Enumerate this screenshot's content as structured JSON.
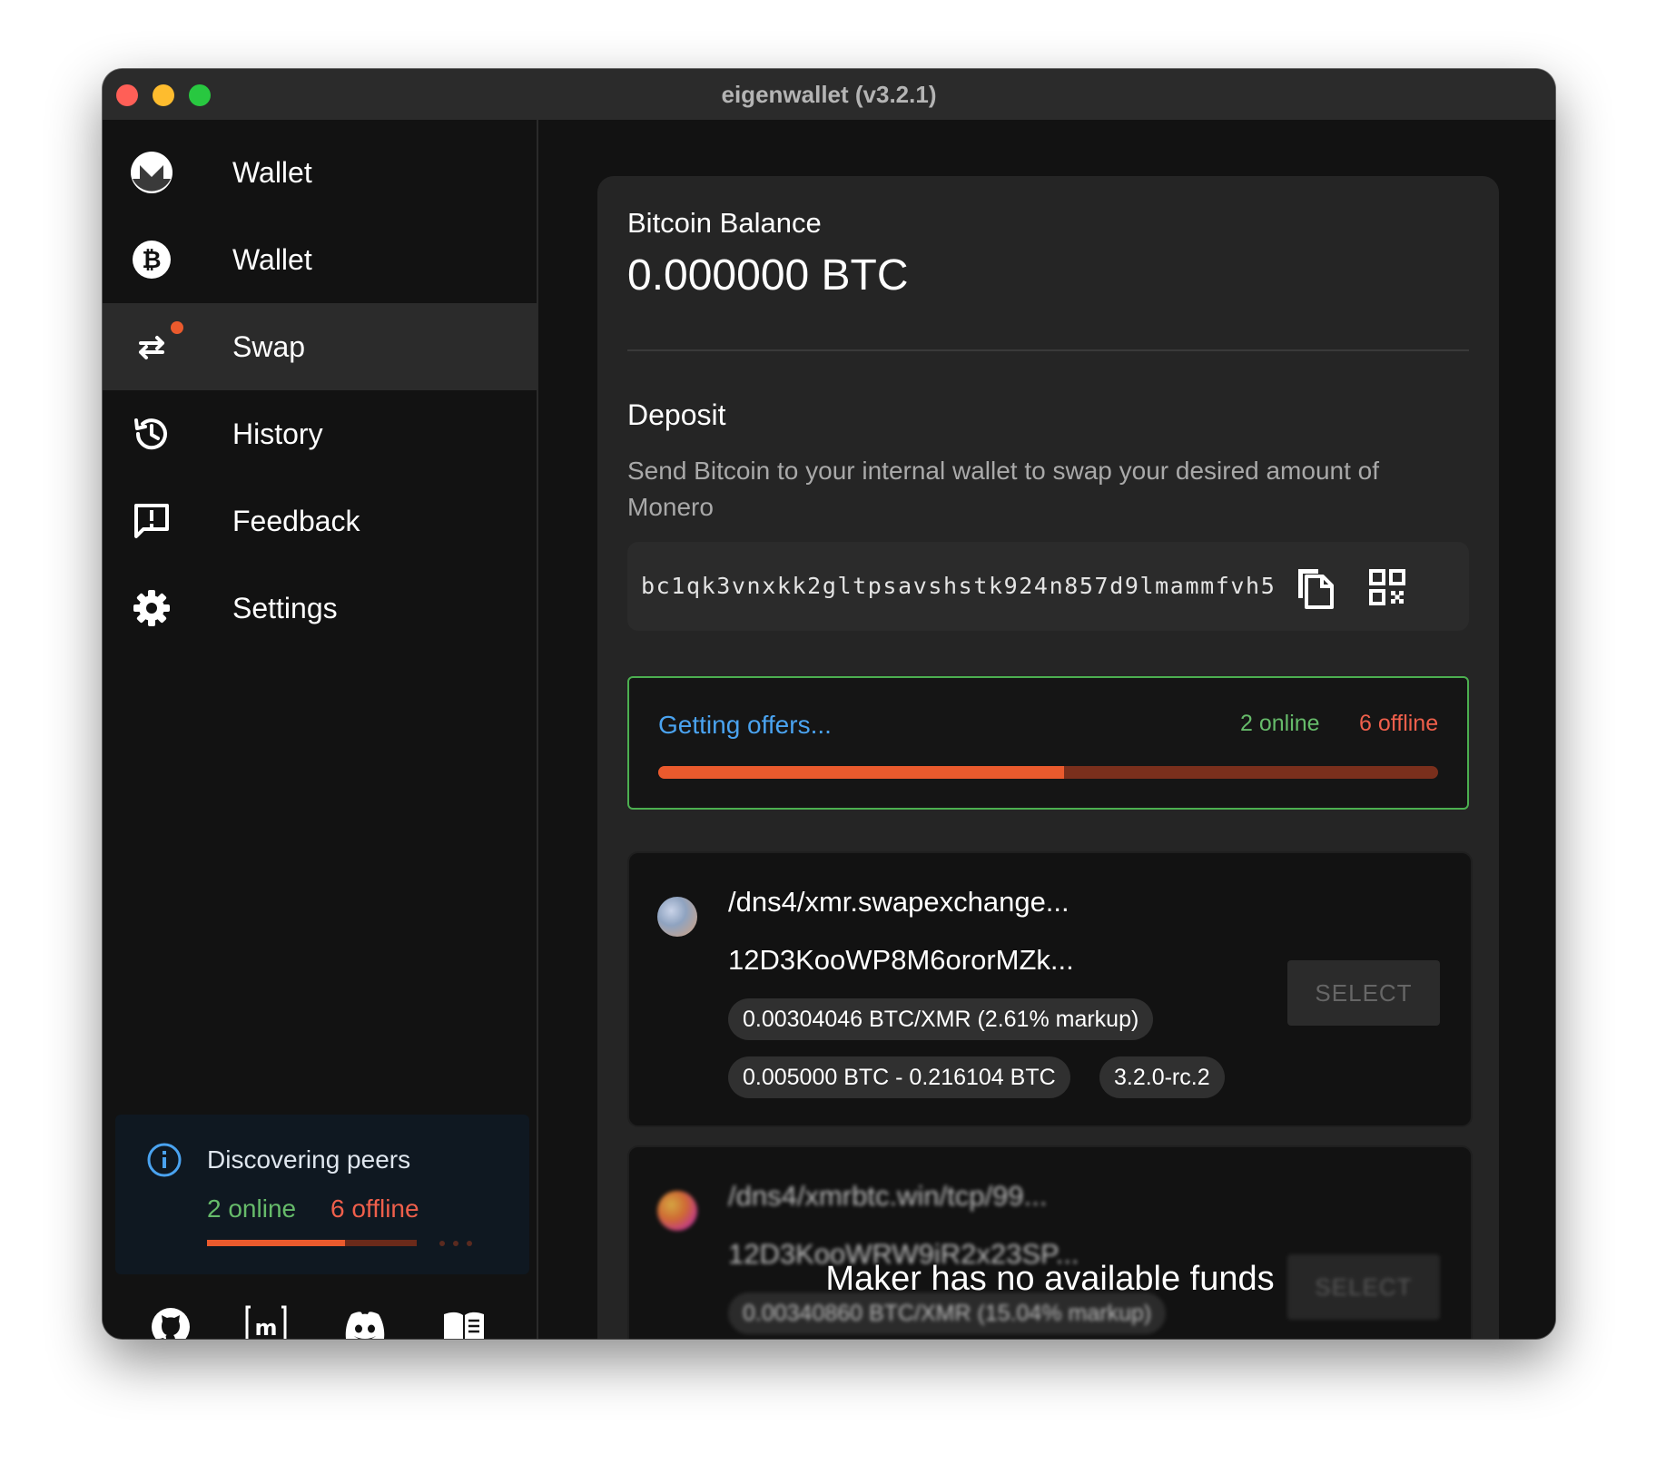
{
  "window": {
    "title": "eigenwallet (v3.2.1)"
  },
  "sidebar": {
    "items": [
      {
        "label": "Wallet",
        "icon": "monero-icon"
      },
      {
        "label": "Wallet",
        "icon": "bitcoin-icon"
      },
      {
        "label": "Swap",
        "icon": "swap-icon",
        "active": true,
        "notification": true
      },
      {
        "label": "History",
        "icon": "history-icon"
      },
      {
        "label": "Feedback",
        "icon": "feedback-icon"
      },
      {
        "label": "Settings",
        "icon": "gear-icon"
      }
    ],
    "peer_status": {
      "title": "Discovering peers",
      "online": "2 online",
      "offline": "6 offline",
      "progress": 0.66
    },
    "footer_icons": [
      "github-icon",
      "matrix-icon",
      "discord-icon",
      "docs-icon"
    ]
  },
  "balance": {
    "label": "Bitcoin Balance",
    "value": "0.000000 BTC"
  },
  "deposit": {
    "title": "Deposit",
    "description": "Send Bitcoin to your internal wallet to swap your desired amount of Monero",
    "address": "bc1qk3vnxkk2gltpsavshstk924n857d9lmammfvh5"
  },
  "offers": {
    "status": "Getting offers...",
    "online": "2 online",
    "offline": "6 offline",
    "progress": 0.52
  },
  "makers": [
    {
      "address": "/dns4/xmr.swapexchange...",
      "peer_id": "12D3KooWP8M6ororMZk...",
      "rate": "0.00304046 BTC/XMR (2.61% markup)",
      "range": "0.005000 BTC - 0.216104 BTC",
      "version": "3.2.0-rc.2",
      "select_label": "SELECT"
    },
    {
      "address": "/dns4/xmrbtc.win/tcp/99...",
      "peer_id": "12D3KooWRW9iR2x23SP...",
      "rate": "0.00340860 BTC/XMR (15.04% markup)",
      "select_label": "SELECT",
      "overlay": "Maker has no available funds"
    }
  ],
  "colors": {
    "accent": "#ea5a2d",
    "online": "#66bb6a",
    "offline": "#ef5f4b",
    "link": "#4aa3f0",
    "border_success": "#4caf50"
  }
}
